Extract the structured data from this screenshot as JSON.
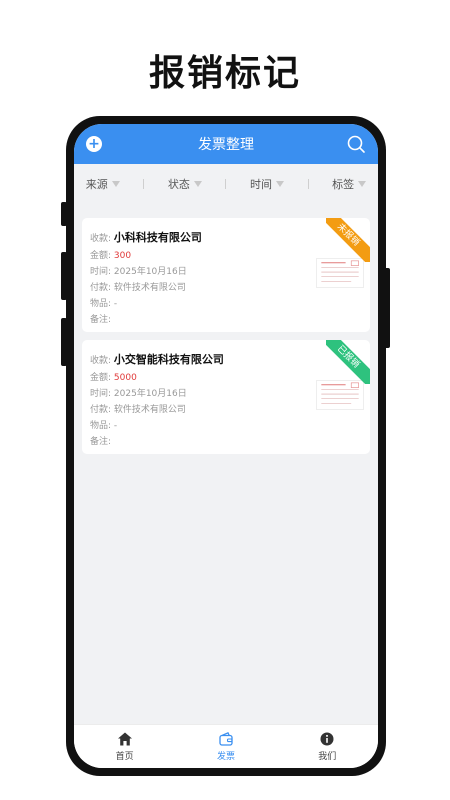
{
  "promo": {
    "title": "报销标记"
  },
  "appbar": {
    "title": "发票整理",
    "add_icon": "plus-circle-icon",
    "search_icon": "search-icon",
    "color": "#3a8ff0"
  },
  "filters": [
    {
      "label": "来源"
    },
    {
      "label": "状态"
    },
    {
      "label": "时间"
    },
    {
      "label": "标签"
    }
  ],
  "invoices": [
    {
      "labels": {
        "payee": "收款:",
        "amount": "金额:",
        "time": "时间:",
        "payer": "付款:",
        "goods": "物品:",
        "note": "备注:"
      },
      "payee": "小科科技有限公司",
      "amount": "300",
      "time": "2025年10月16日",
      "payer": "软件技术有限公司",
      "goods": "-",
      "note": "",
      "status": "未报销",
      "status_color": "#f39c12"
    },
    {
      "labels": {
        "payee": "收款:",
        "amount": "金额:",
        "time": "时间:",
        "payer": "付款:",
        "goods": "物品:",
        "note": "备注:"
      },
      "payee": "小交智能科技有限公司",
      "amount": "5000",
      "time": "2025年10月16日",
      "payer": "软件技术有限公司",
      "goods": "-",
      "note": "",
      "status": "已报销",
      "status_color": "#2ec27e"
    }
  ],
  "tabbar": {
    "tabs": [
      {
        "label": "首页",
        "icon": "home-icon"
      },
      {
        "label": "发票",
        "icon": "wallet-icon",
        "active": true
      },
      {
        "label": "我们",
        "icon": "info-icon"
      }
    ]
  }
}
